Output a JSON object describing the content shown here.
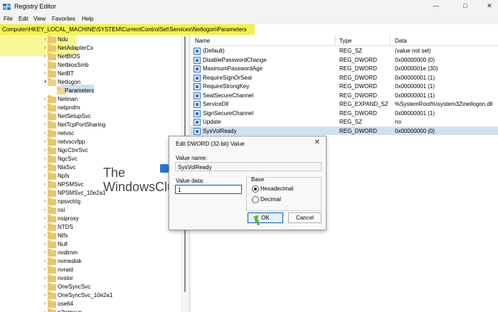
{
  "window": {
    "title": "Registry Editor",
    "controls": {
      "minimize": "—",
      "maximize": "□",
      "close": "✕"
    }
  },
  "menu": [
    "File",
    "Edit",
    "View",
    "Favorites",
    "Help"
  ],
  "address": "Computer\\HKEY_LOCAL_MACHINE\\SYSTEM\\CurrentControlSet\\Services\\Netlogon\\Parameters",
  "tree": [
    {
      "label": "Ndu"
    },
    {
      "label": "NetAdapterCx"
    },
    {
      "label": "NetBIOS"
    },
    {
      "label": "NetbiosSmb"
    },
    {
      "label": "NetBT"
    },
    {
      "label": "Netlogon"
    },
    {
      "label": "Parameters"
    },
    {
      "label": "Netman"
    },
    {
      "label": "netprofm"
    },
    {
      "label": "NetSetupSvc"
    },
    {
      "label": "NetTcpPortSharing"
    },
    {
      "label": "netvsc"
    },
    {
      "label": "netvscvfpp"
    },
    {
      "label": "NgcCtnrSvc"
    },
    {
      "label": "NgcSvc"
    },
    {
      "label": "NlaSvc"
    },
    {
      "label": "Npfs"
    },
    {
      "label": "NPSMSvc"
    },
    {
      "label": "NPSMSvc_10e2a1"
    },
    {
      "label": "npsvctrig"
    },
    {
      "label": "nsi"
    },
    {
      "label": "nsiproxy"
    },
    {
      "label": "NTDS"
    },
    {
      "label": "Ntfs"
    },
    {
      "label": "Null"
    },
    {
      "label": "nvdimm"
    },
    {
      "label": "nvmedisk"
    },
    {
      "label": "nvraid"
    },
    {
      "label": "nvstor"
    },
    {
      "label": "OneSyncSvc"
    },
    {
      "label": "OneSyncSvc_10e2a1"
    },
    {
      "label": "ose64"
    },
    {
      "label": "p2pimsvc"
    }
  ],
  "columns": {
    "name": "Name",
    "type": "Type",
    "data": "Data"
  },
  "values": [
    {
      "name": "(Default)",
      "type": "REG_SZ",
      "data": "(value not set)"
    },
    {
      "name": "DisablePasswordChange",
      "type": "REG_DWORD",
      "data": "0x00000000 (0)"
    },
    {
      "name": "MaximumPasswordAge",
      "type": "REG_DWORD",
      "data": "0x0000001e (30)"
    },
    {
      "name": "RequireSignOrSeal",
      "type": "REG_DWORD",
      "data": "0x00000001 (1)"
    },
    {
      "name": "RequireStrongKey",
      "type": "REG_DWORD",
      "data": "0x00000001 (1)"
    },
    {
      "name": "SealSecureChannel",
      "type": "REG_DWORD",
      "data": "0x00000001 (1)"
    },
    {
      "name": "ServiceDll",
      "type": "REG_EXPAND_SZ",
      "data": "%SystemRoot%\\system32\\netlogon.dll"
    },
    {
      "name": "SignSecureChannel",
      "type": "REG_DWORD",
      "data": "0x00000001 (1)"
    },
    {
      "name": "Update",
      "type": "REG_SZ",
      "data": "no"
    },
    {
      "name": "SysVolReady",
      "type": "REG_DWORD",
      "data": "0x00000000 (0)"
    }
  ],
  "dialog": {
    "title": "Edit DWORD (32-bit) Value",
    "value_name_label": "Value name:",
    "value_name": "SysVolReady",
    "value_data_label": "Value data:",
    "value_data": "1",
    "base_label": "Base",
    "hex_label": "Hexadecimal",
    "dec_label": "Decimal",
    "ok": "OK",
    "cancel": "Cancel"
  },
  "watermark": {
    "line1": "The",
    "line2": "WindowsClub"
  },
  "colors": {
    "highlight": "#f2f24b",
    "folder": "#e8c76c",
    "selection": "#cfe0f1",
    "accent": "#005fb8"
  }
}
